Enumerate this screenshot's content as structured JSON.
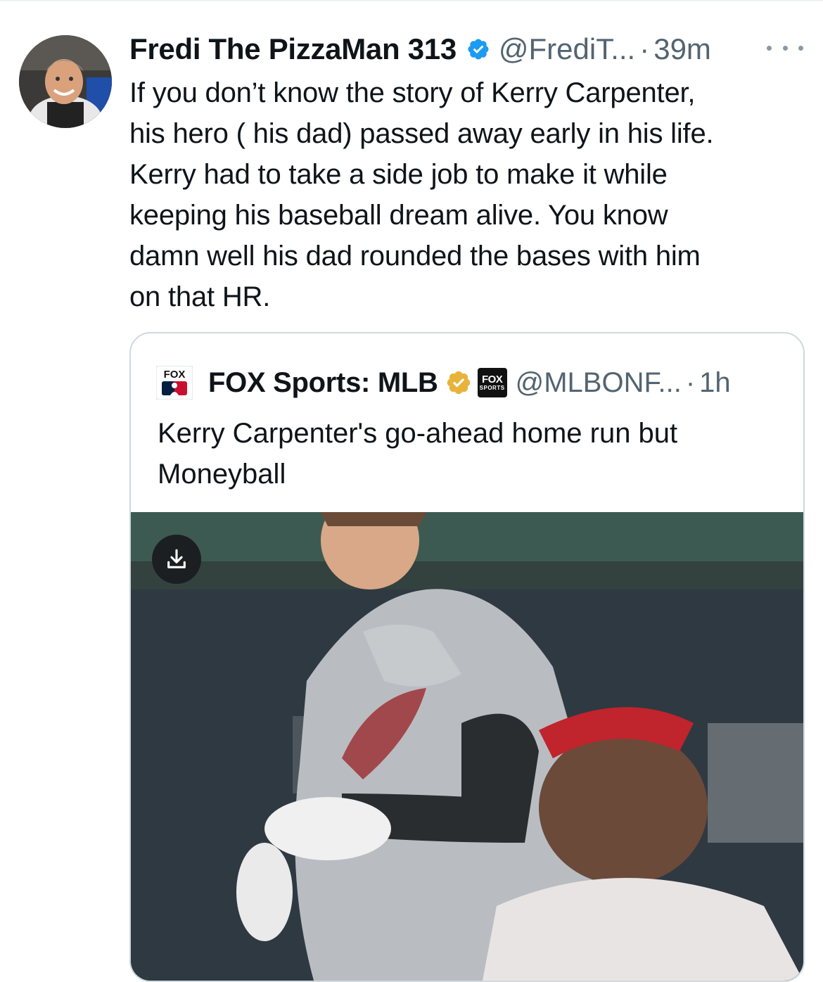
{
  "tweet": {
    "author_name": "Fredi The PizzaMan 313",
    "handle": "@FrediT...",
    "separator": "·",
    "time": "39m",
    "text": "If you don’t know the story of Kerry Carpenter,\nhis hero ( his dad) passed away early in his life.\nKerry had to take a side job to make it while\nkeeping his baseball dream alive. You know\ndamn well his dad rounded the bases with him\non that HR."
  },
  "quoted_tweet": {
    "author_name": "FOX Sports: MLB",
    "affiliate_badge": {
      "line1": "FOX",
      "line2": "SPORTS"
    },
    "logo_text": "FOX",
    "handle": "@MLBONF...",
    "separator": "·",
    "time": "1h",
    "text": "Kerry Carpenter's go-ahead home run but\nMoneyball"
  },
  "icons": {
    "verified": "verified-badge-icon",
    "gold_verified": "gold-verified-badge-icon",
    "more": "more-options-icon",
    "download": "download-icon"
  },
  "colors": {
    "verified_blue": "#1d9bf0",
    "gold": "#e8b33a",
    "secondary_text": "#536471",
    "border": "#cfd9de"
  }
}
